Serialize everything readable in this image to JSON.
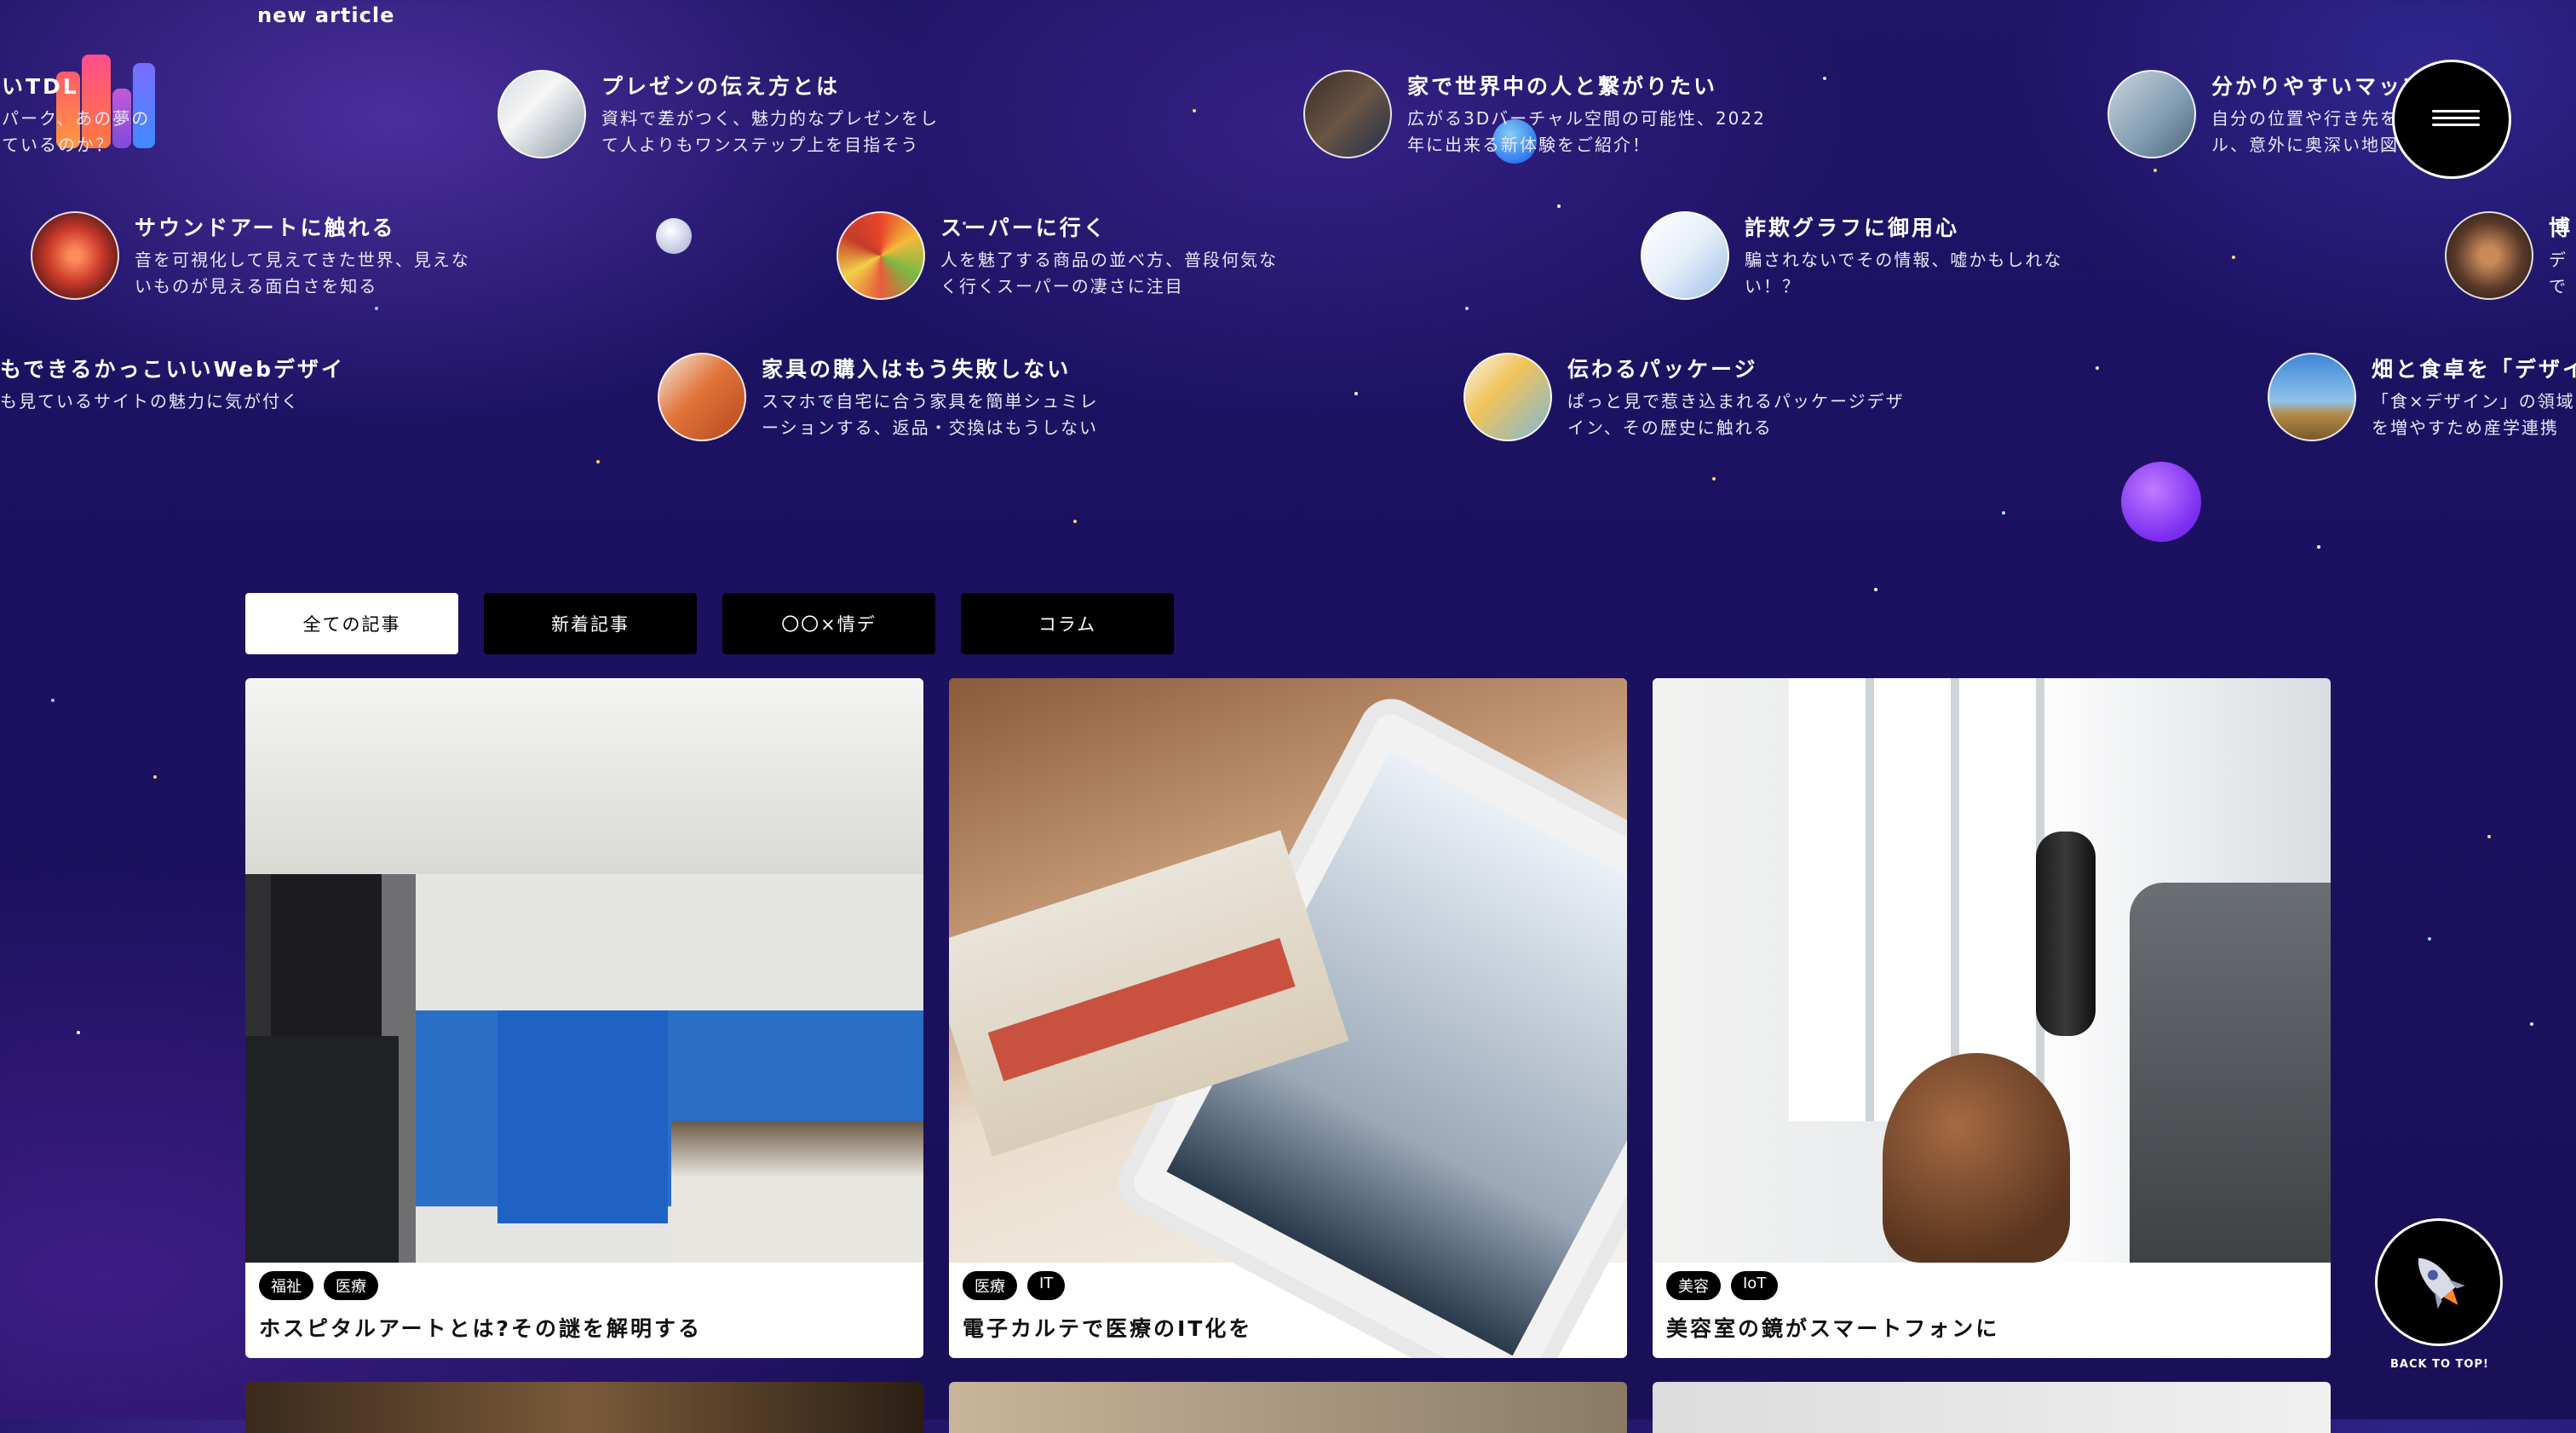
{
  "section": {
    "heading": "new article"
  },
  "logo": {
    "alt": "idd"
  },
  "marquee_rows": [
    [
      {
        "title": "いTDL",
        "desc": "パーク、あの夢の\nているのか？",
        "thumb": "globe-photo"
      },
      {
        "title": "プレゼンの伝え方とは",
        "desc": "資料で差がつく、魅力的なプレゼンをし\nて人よりもワンステップ上を目指そう",
        "thumb": "presentation-photo"
      },
      {
        "title": "家で世界中の人と繋がりたい",
        "desc": "広がる3Dバーチャル空間の可能性、2022\n年に出来る新体験をご紹介！",
        "thumb": "vr-photo"
      },
      {
        "title": "分かりやすいマップ",
        "desc": "自分の位置や行き先をつなげるツー\nル、意外に奥深い地図に気が付",
        "thumb": "map-photo"
      }
    ],
    [
      {
        "title": "サウンドアートに触れる",
        "desc": "音を可視化して見えてきた世界、見えな\nいものが見える面白さを知る",
        "thumb": "sound-art-photo"
      },
      {
        "title": "スーパーに行く",
        "desc": "人を魅了する商品の並べ方、普段何気な\nく行くスーパーの凄さに注目",
        "thumb": "supermarket-photo"
      },
      {
        "title": "詐欺グラフに御用心",
        "desc": "騙されないでその情報、嘘かもしれな\nい！？",
        "thumb": "graph-photo"
      },
      {
        "title": "博",
        "desc": "デ\nで",
        "thumb": "museum-photo"
      }
    ],
    [
      {
        "title": "もできるかっこいいWebデザイ",
        "desc": "も見ているサイトの魅力に気が付く",
        "thumb": ""
      },
      {
        "title": "家具の購入はもう失敗しない",
        "desc": "スマホで自宅に合う家具を簡単シュミレ\nーションする、返品・交換はもうしない",
        "thumb": "furniture-photo"
      },
      {
        "title": "伝わるパッケージ",
        "desc": "ぱっと見で惹き込まれるパッケージデザ\nイン、その歴史に触れる",
        "thumb": "package-photo"
      },
      {
        "title": "畑と食卓を「デザイ",
        "desc": "「食×デザイン」の領域\nを増やすため産学連携",
        "thumb": "field-photo"
      }
    ]
  ],
  "filters": [
    {
      "label": "全ての記事",
      "active": true
    },
    {
      "label": "新着記事",
      "active": false
    },
    {
      "label": "〇〇×情デ",
      "active": false
    },
    {
      "label": "コラム",
      "active": false
    }
  ],
  "cards": [
    {
      "tags": [
        "福祉",
        "医療"
      ],
      "title": "ホスピタルアートとは?その謎を解明する",
      "image": "hospital-lobby-photo"
    },
    {
      "tags": [
        "医療",
        "IT"
      ],
      "title": "電子カルテで医療のIT化を",
      "image": "tablet-newspaper-photo"
    },
    {
      "tags": [
        "美容",
        "IoT"
      ],
      "title": "美容室の鏡がスマートフォンに",
      "image": "hair-salon-photo"
    }
  ],
  "back_to_top": {
    "label": "BACK TO TOP!"
  },
  "colors": {
    "background": "#1c1262",
    "tab_active_bg": "#ffffff",
    "tab_bg": "#000000",
    "tag_bg": "#000000"
  }
}
